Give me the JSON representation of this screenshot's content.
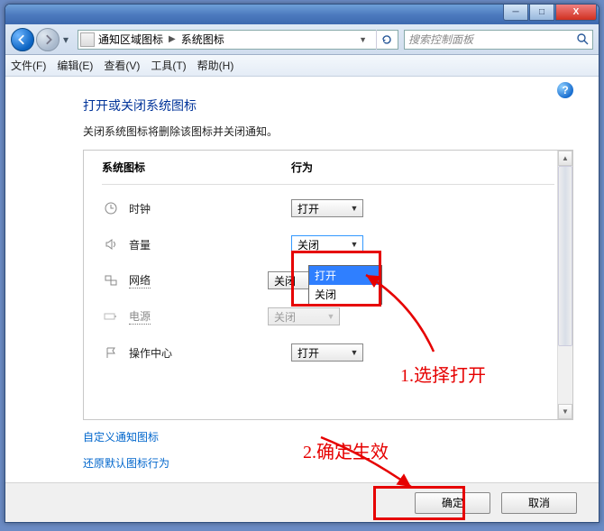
{
  "window": {
    "min_glyph": "─",
    "max_glyph": "□",
    "close_glyph": "X"
  },
  "nav": {
    "breadcrumb1": "通知区域图标",
    "breadcrumb2": "系统图标",
    "search_placeholder": "搜索控制面板"
  },
  "menu": {
    "file": "文件(F)",
    "edit": "编辑(E)",
    "view": "查看(V)",
    "tools": "工具(T)",
    "help": "帮助(H)"
  },
  "page": {
    "title": "打开或关闭系统图标",
    "subtitle": "关闭系统图标将删除该图标并关闭通知。",
    "col_icon": "系统图标",
    "col_behavior": "行为"
  },
  "rows": {
    "clock": {
      "label": "时钟",
      "value": "打开"
    },
    "volume": {
      "label": "音量",
      "value": "关闭"
    },
    "network": {
      "label": "网络",
      "value": "关闭"
    },
    "power": {
      "label": "电源",
      "value": "关闭"
    },
    "actioncenter": {
      "label": "操作中心",
      "value": "打开"
    }
  },
  "dropdown": {
    "opt_open": "打开",
    "opt_close": "关闭"
  },
  "links": {
    "custom": "自定义通知图标",
    "restore": "还原默认图标行为"
  },
  "footer": {
    "ok": "确定",
    "cancel": "取消"
  },
  "annotations": {
    "step1": "1.选择打开",
    "step2": "2.确定生效"
  }
}
